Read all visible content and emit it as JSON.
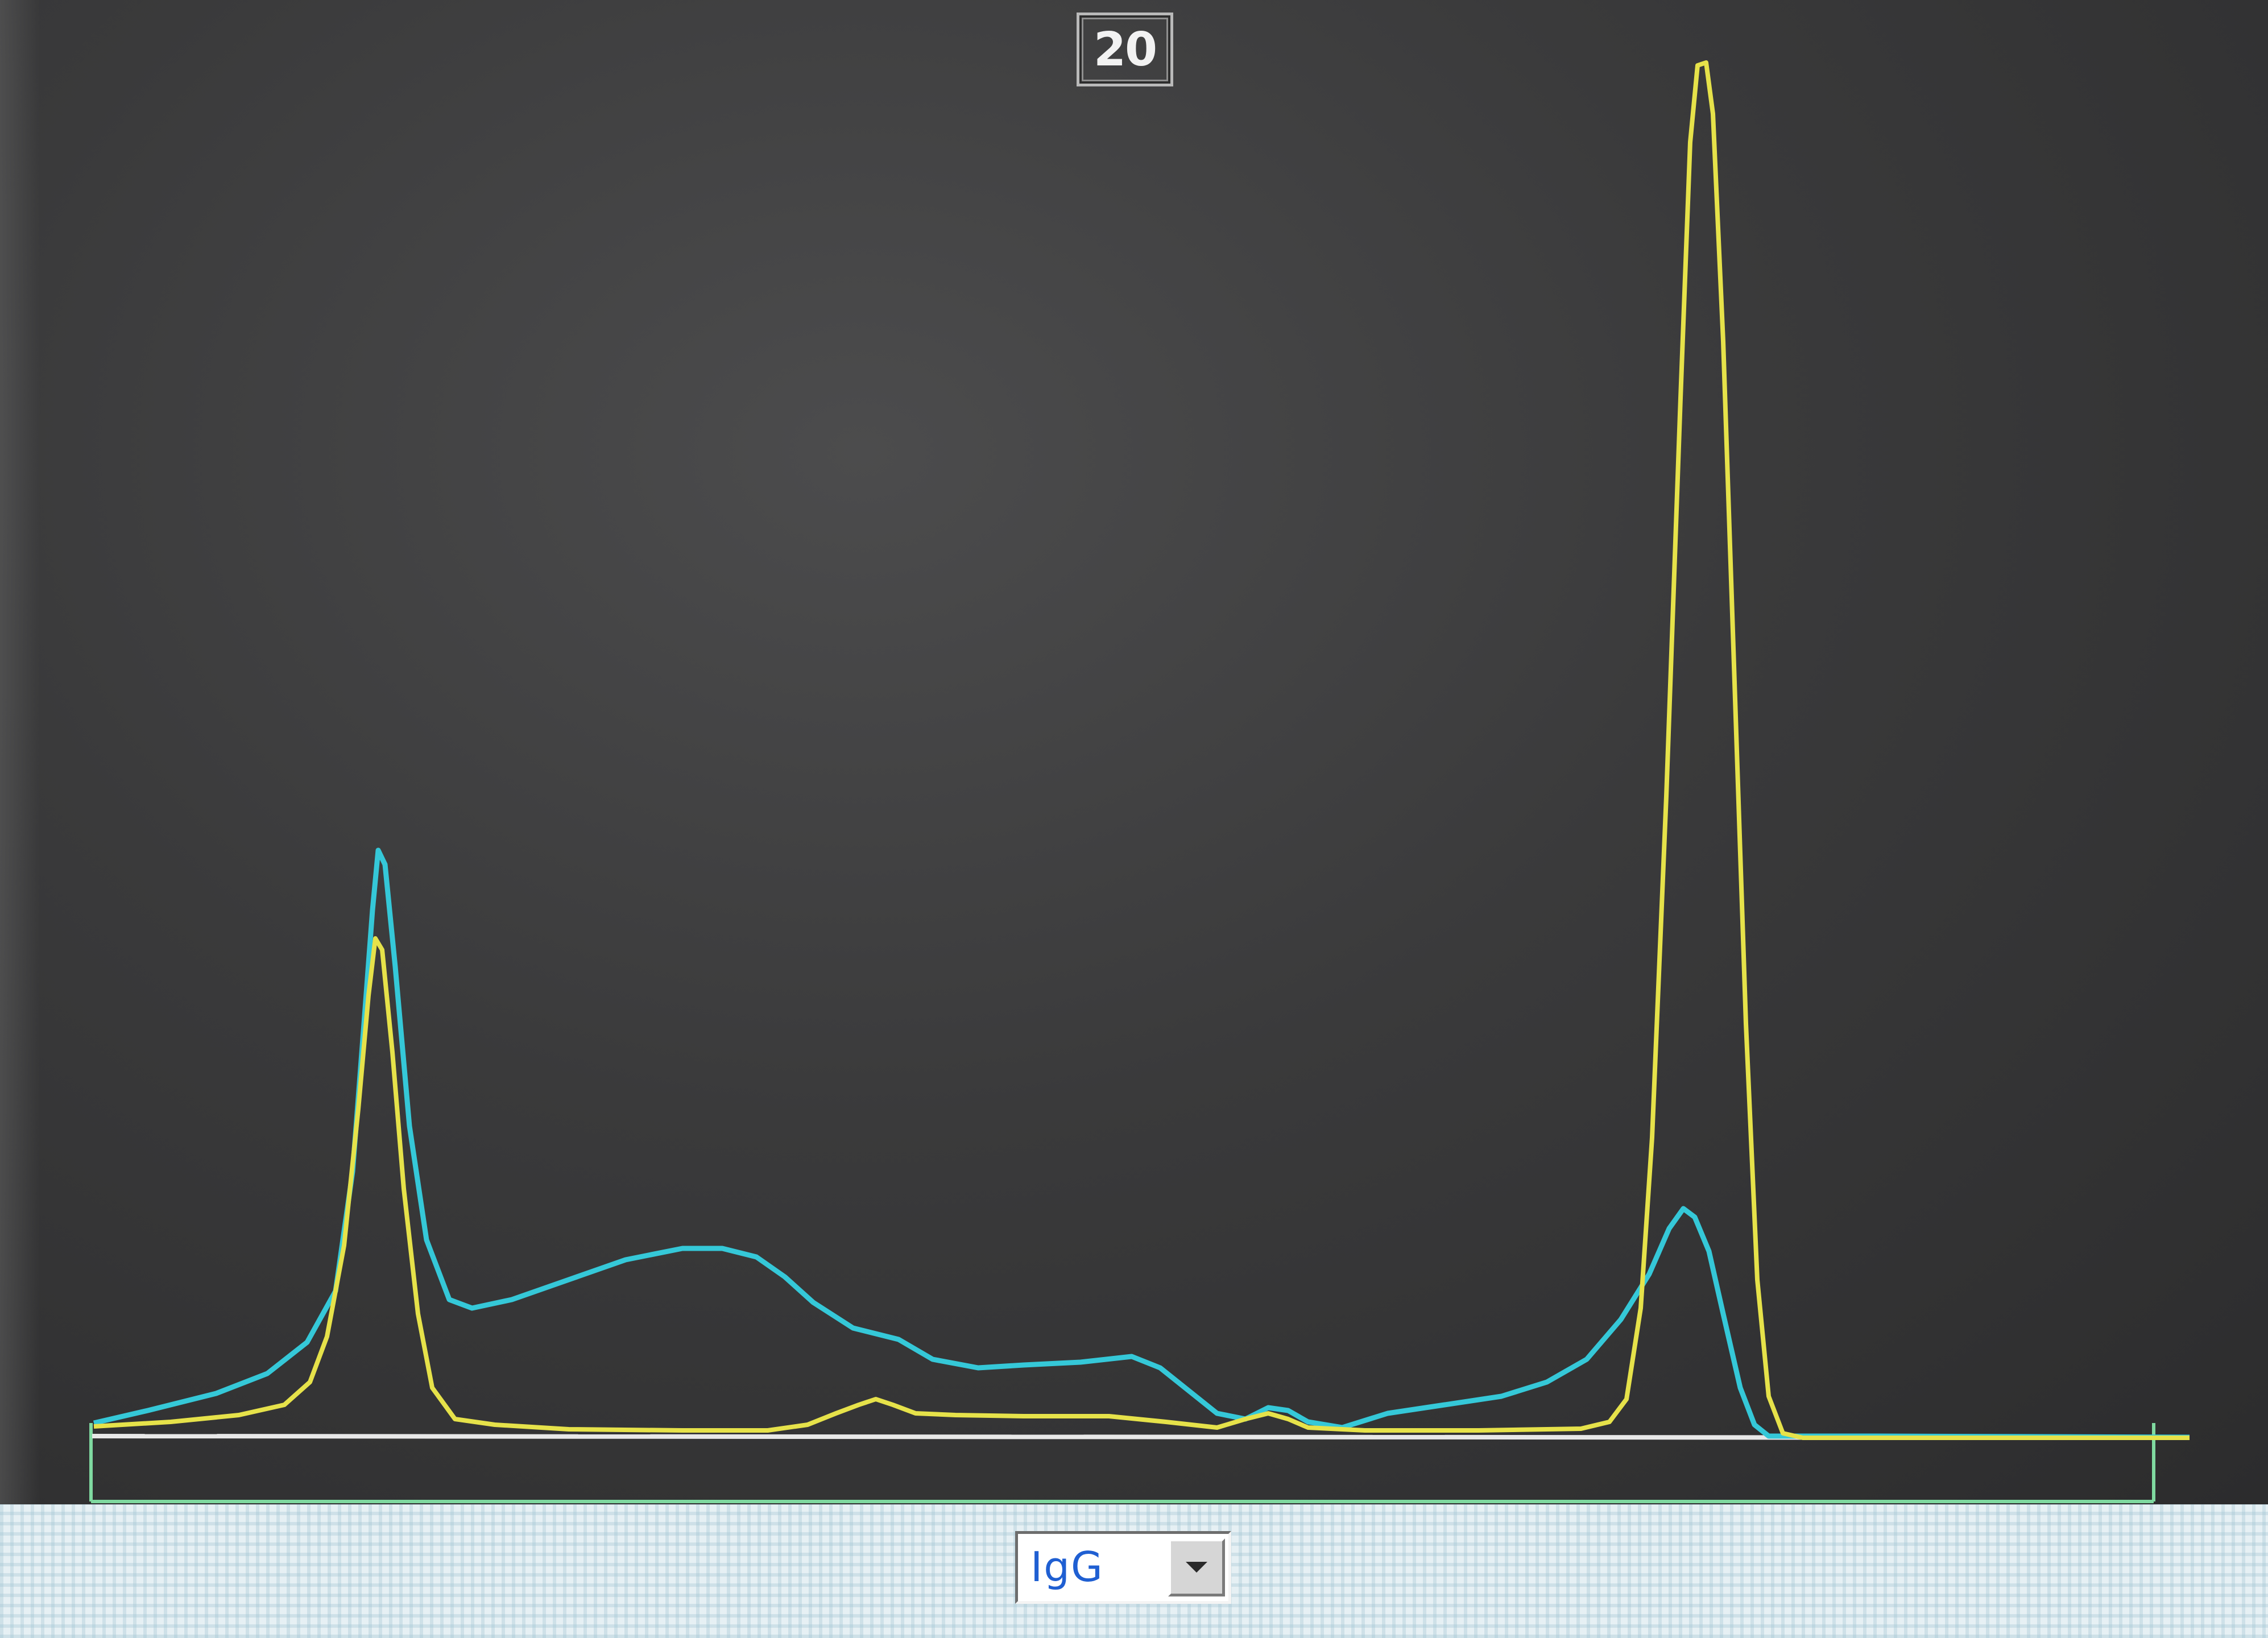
{
  "header": {
    "sample_number": "20"
  },
  "selector": {
    "selected": "IgG"
  },
  "colors": {
    "plot_background": "#3a3a3b",
    "trace_reference": "#35c8d8",
    "trace_fraction": "#e6e24a",
    "baseline": "#e8e8e8",
    "bracket": "#7fd9a0",
    "select_text": "#1f5fd2"
  },
  "icons": {
    "dropdown": "chevron-down-icon"
  }
}
